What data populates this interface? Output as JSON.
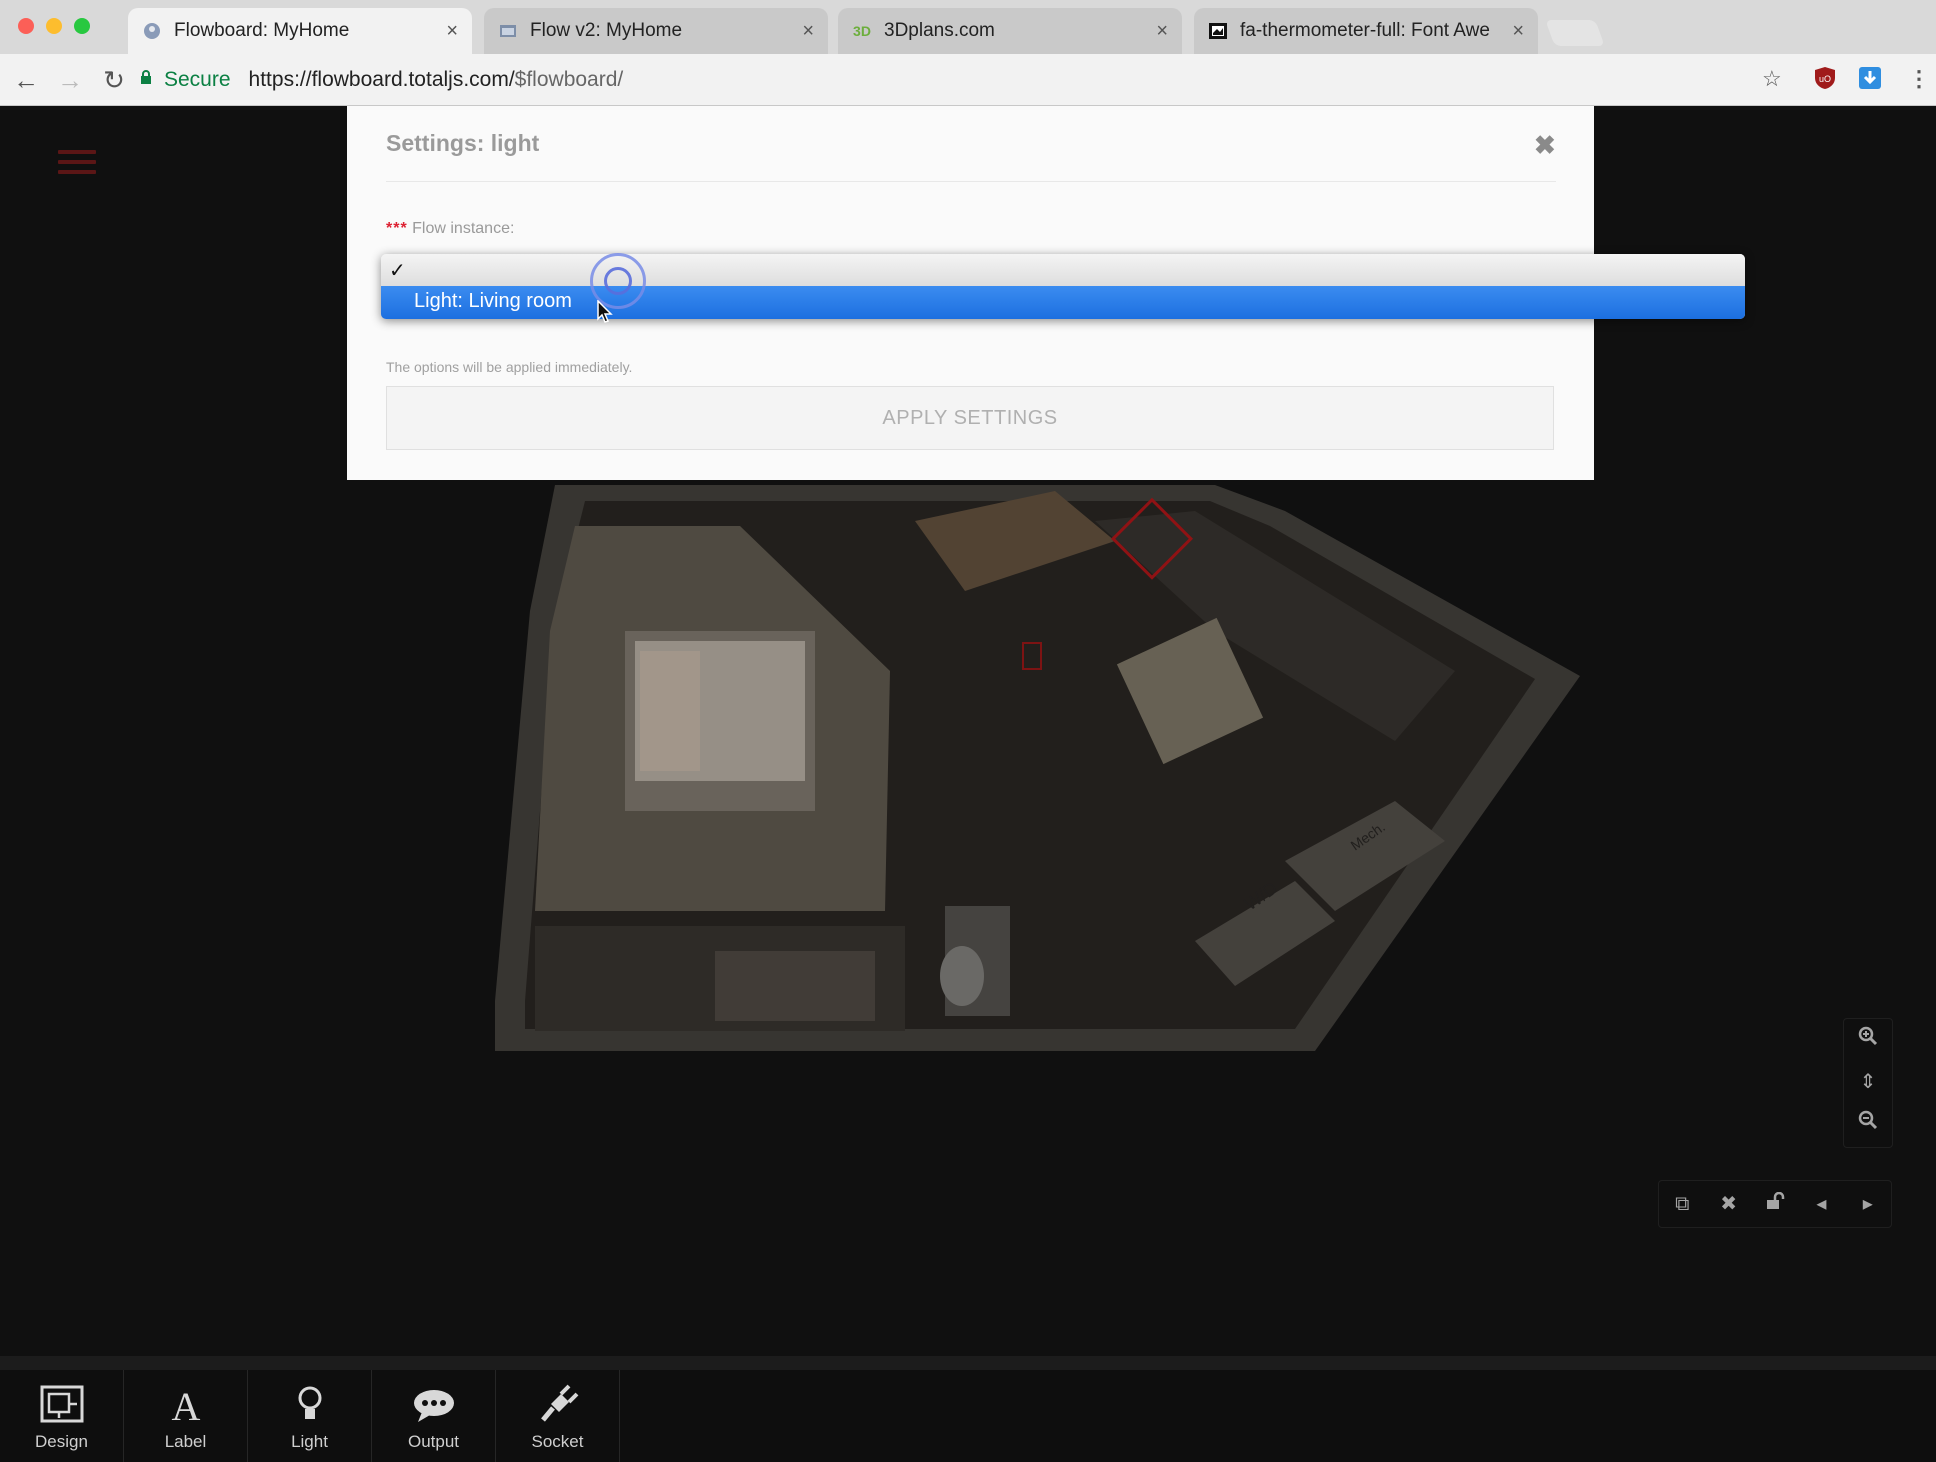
{
  "browser": {
    "tabs": [
      {
        "title": "Flowboard: MyHome",
        "active": true,
        "favicon": "totaljs-icon"
      },
      {
        "title": "Flow v2: MyHome",
        "active": false,
        "favicon": "window-icon"
      },
      {
        "title": "3Dplans.com",
        "active": false,
        "favicon": "3dplans-icon"
      },
      {
        "title": "fa-thermometer-full: Font Awe",
        "active": false,
        "favicon": "flag-icon"
      }
    ],
    "secure_label": "Secure",
    "url_host": "https://flowboard.totaljs.com/",
    "url_path": "$flowboard/"
  },
  "modal": {
    "title": "Settings: light",
    "field_label": "Flow instance:",
    "required_marker": "***",
    "help_text": "The options will be applied immediately.",
    "apply_label": "APPLY SETTINGS"
  },
  "dropdown": {
    "checked_mark": "✓",
    "options": [
      "",
      "Light: Living room"
    ],
    "highlighted": "Light: Living room"
  },
  "bottombar": {
    "items": [
      {
        "label": "Design",
        "icon": "design-icon"
      },
      {
        "label": "Label",
        "icon": "label-icon"
      },
      {
        "label": "Light",
        "icon": "lightbulb-icon"
      },
      {
        "label": "Output",
        "icon": "comment-icon"
      },
      {
        "label": "Socket",
        "icon": "plug-icon"
      }
    ]
  },
  "colors": {
    "accent": "#1c6fe0",
    "secure": "#0b8043",
    "menu": "#7a1e1e"
  }
}
